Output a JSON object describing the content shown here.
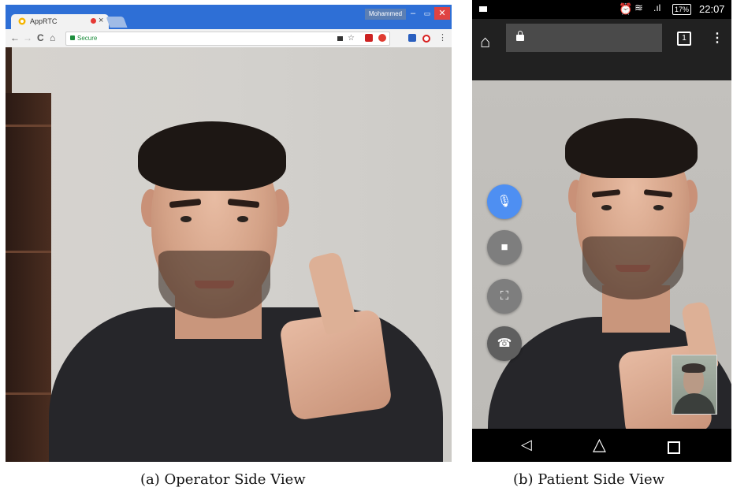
{
  "left_panel": {
    "tab": {
      "title": "AppRTC",
      "close": "×"
    },
    "window": {
      "user": "Mohammed",
      "minimize": "–",
      "maximize": "▭",
      "close": "✕"
    },
    "toolbar": {
      "back": "←",
      "forward": "→",
      "reload": "C",
      "home": "⌂",
      "secure_label": "Secure",
      "star": "☆",
      "menu": "⋮"
    },
    "icons": [
      "favicon-icon",
      "recording-dot-icon",
      "lock-icon",
      "camera-icon",
      "star-icon",
      "extension-icon",
      "extension-icon",
      "extension-icon",
      "opera-icon",
      "menu-icon"
    ]
  },
  "right_panel": {
    "status": {
      "time": "22:07",
      "battery": "17%",
      "alarm": "⏰",
      "wifi": "≋",
      "signal": ".ıl"
    },
    "appbar": {
      "home": "⌂",
      "tab_count": "1",
      "menu": "⋮"
    },
    "controls": [
      {
        "name": "mute-mic",
        "icon": "🎙",
        "active": true,
        "color": "#4e8ff2"
      },
      {
        "name": "toggle-video",
        "icon": "■"
      },
      {
        "name": "fullscreen",
        "icon": "⛶"
      },
      {
        "name": "hang-up",
        "icon": "☎"
      }
    ],
    "navbar": {
      "back": "◁",
      "home": "△"
    }
  },
  "captions": {
    "a": "(a) Operator Side View",
    "b": "(b) Patient Side View"
  }
}
